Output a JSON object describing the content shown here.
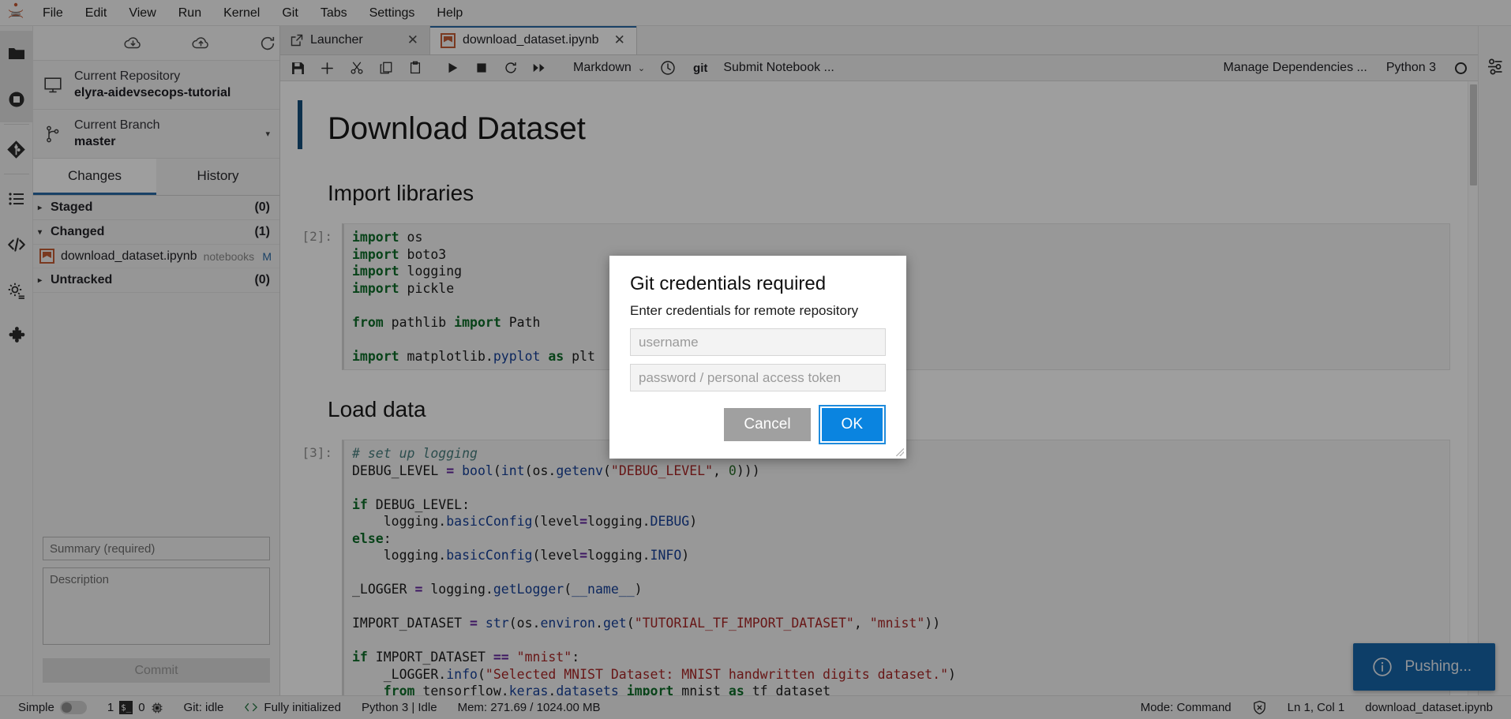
{
  "menubar": {
    "logo_name": "jupyter-logo",
    "items": [
      "File",
      "Edit",
      "View",
      "Run",
      "Kernel",
      "Git",
      "Tabs",
      "Settings",
      "Help"
    ]
  },
  "activitybar": {
    "items": [
      {
        "name": "file-browser-icon",
        "glyph": "folder"
      },
      {
        "name": "running-terminals-icon",
        "glyph": "stop-circle"
      },
      {
        "name": "git-icon",
        "glyph": "git"
      },
      {
        "name": "table-of-contents-icon",
        "glyph": "list"
      },
      {
        "name": "extension-code-icon",
        "glyph": "code"
      },
      {
        "name": "settings-gear-icon",
        "glyph": "gear"
      },
      {
        "name": "extension-manager-icon",
        "glyph": "puzzle"
      }
    ]
  },
  "sidebar": {
    "toolbar": [
      {
        "name": "git-pull-button",
        "title": "Pull latest changes"
      },
      {
        "name": "git-push-button",
        "title": "Push committed changes"
      },
      {
        "name": "git-refresh-button",
        "title": "Refresh the repository"
      }
    ],
    "repository": {
      "label": "Current Repository",
      "value": "elyra-aidevsecops-tutorial"
    },
    "branch": {
      "label": "Current Branch",
      "value": "master",
      "caret": "▾"
    },
    "tabs": [
      {
        "label": "Changes",
        "active": true
      },
      {
        "label": "History",
        "active": false
      }
    ],
    "sections": [
      {
        "name": "staged",
        "label": "Staged",
        "count": "(0)",
        "expanded": false,
        "tri": "▸",
        "files": []
      },
      {
        "name": "changed",
        "label": "Changed",
        "count": "(1)",
        "expanded": true,
        "tri": "▾",
        "files": [
          {
            "filename": "download_dataset.ipynb",
            "directory": "notebooks",
            "status": "M"
          }
        ]
      },
      {
        "name": "untracked",
        "label": "Untracked",
        "count": "(0)",
        "expanded": false,
        "tri": "▸",
        "files": []
      }
    ],
    "commit": {
      "summary_value": "",
      "summary_placeholder": "Summary (required)",
      "description_value": "",
      "description_placeholder": "Description",
      "button_label": "Commit"
    }
  },
  "dock": {
    "tabs": [
      {
        "label": "Launcher",
        "icon": "launcher-icon",
        "active": false,
        "close": "✕"
      },
      {
        "label": "download_dataset.ipynb",
        "icon": "notebook-icon",
        "active": true,
        "close": "✕"
      }
    ],
    "notebook_toolbar": {
      "buttons": [
        {
          "name": "save-button",
          "glyph": "save"
        },
        {
          "name": "insert-cell-button",
          "glyph": "plus"
        },
        {
          "name": "cut-cell-button",
          "glyph": "scissors"
        },
        {
          "name": "copy-cell-button",
          "glyph": "copy"
        },
        {
          "name": "paste-cell-button",
          "glyph": "clipboard"
        },
        {
          "name": "run-cell-button",
          "glyph": "play"
        },
        {
          "name": "interrupt-kernel-button",
          "glyph": "stop"
        },
        {
          "name": "restart-kernel-button",
          "glyph": "restart"
        },
        {
          "name": "restart-run-all-button",
          "glyph": "fast-forward"
        }
      ],
      "cell_type": "Markdown",
      "cell_type_chevron": "⌄",
      "history_icon": "clock-icon",
      "git_label": "git",
      "submit_notebook": "Submit Notebook ...",
      "manage_dependencies": "Manage Dependencies ...",
      "kernel_name": "Python 3"
    }
  },
  "notebook": {
    "cells": [
      {
        "type": "markdown",
        "level": 1,
        "text": "Download Dataset",
        "selected": true
      },
      {
        "type": "markdown",
        "level": 2,
        "text": "Import libraries",
        "selected": false
      },
      {
        "type": "code",
        "prompt": "[2]:",
        "source": "import os\nimport boto3\nimport logging\nimport pickle\n\nfrom pathlib import Path\n\nimport matplotlib.pyplot as plt"
      },
      {
        "type": "markdown",
        "level": 2,
        "text": "Load data",
        "selected": false
      },
      {
        "type": "code",
        "prompt": "[3]:",
        "source": "# set up logging\nDEBUG_LEVEL = bool(int(os.getenv(\"DEBUG_LEVEL\", 0)))\n\nif DEBUG_LEVEL:\n    logging.basicConfig(level=logging.DEBUG)\nelse:\n    logging.basicConfig(level=logging.INFO)\n\n_LOGGER = logging.getLogger(__name__)\n\nIMPORT_DATASET = str(os.environ.get(\"TUTORIAL_TF_IMPORT_DATASET\", \"mnist\"))\n\nif IMPORT_DATASET == \"mnist\":\n    _LOGGER.info(\"Selected MNIST Dataset: MNIST handwritten digits dataset.\")\n    from tensorflow.keras.datasets import mnist as tf_dataset"
      }
    ]
  },
  "dialog": {
    "title": "Git credentials required",
    "subtitle": "Enter credentials for remote repository",
    "username_value": "",
    "username_placeholder": "username",
    "password_value": "",
    "password_placeholder": "password / personal access token",
    "cancel_label": "Cancel",
    "ok_label": "OK"
  },
  "toast": {
    "icon": "info-icon",
    "message": "Pushing..."
  },
  "statusbar": {
    "left": {
      "mode_label": "Simple",
      "kernel_count": "1",
      "terminal_badge": "$_",
      "terminal_count": "0",
      "git_status": "Git: idle",
      "elyra_status": "Fully initialized",
      "kernel_status": "Python 3 | Idle",
      "memory": "Mem: 271.69 / 1024.00 MB"
    },
    "right": {
      "mode": "Mode: Command",
      "cursor": "Ln 1, Col 1",
      "filename": "download_dataset.ipynb"
    }
  },
  "colors": {
    "accent_blue": "#0a84e0",
    "toast_blue": "#0a66b5",
    "tab_underline": "#1f6ab0",
    "notebook_orange": "#d3582a",
    "cell_selected_bar": "#0b4f84"
  }
}
